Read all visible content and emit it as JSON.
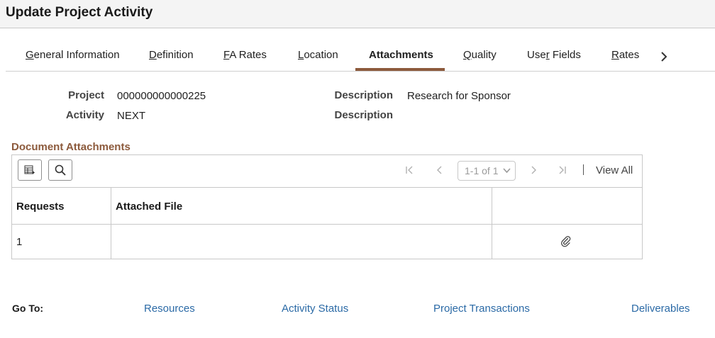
{
  "page": {
    "title": "Update Project Activity"
  },
  "tabs": [
    {
      "prefix": "",
      "underlined": "G",
      "rest": "eneral Information",
      "active": false
    },
    {
      "prefix": "",
      "underlined": "D",
      "rest": "efinition",
      "active": false
    },
    {
      "prefix": "",
      "underlined": "F",
      "rest": "A Rates",
      "active": false
    },
    {
      "prefix": "",
      "underlined": "L",
      "rest": "ocation",
      "active": false
    },
    {
      "prefix": "",
      "underlined": "",
      "rest": "Attachments",
      "active": true
    },
    {
      "prefix": "",
      "underlined": "Q",
      "rest": "uality",
      "active": false
    },
    {
      "prefix": "Use",
      "underlined": "r",
      "rest": " Fields",
      "active": false
    },
    {
      "prefix": "",
      "underlined": "R",
      "rest": "ates",
      "active": false
    }
  ],
  "header_fields": {
    "project_label": "Project",
    "project_value": "000000000000225",
    "activity_label": "Activity",
    "activity_value": "NEXT",
    "project_desc_label": "Description",
    "project_desc_value": "Research for Sponsor",
    "activity_desc_label": "Description",
    "activity_desc_value": ""
  },
  "attachments": {
    "section_title": "Document Attachments",
    "pager_text": "1-1 of 1",
    "view_all": "View All",
    "columns": [
      "Requests",
      "Attached File",
      ""
    ],
    "rows": [
      {
        "requests": "1",
        "attached_file": ""
      }
    ]
  },
  "goto": {
    "label": "Go To:",
    "links": [
      "Resources",
      "Activity Status",
      "Project Transactions",
      "Deliverables"
    ]
  },
  "colors": {
    "accent": "#8c5a3c",
    "link": "#2b6aa6"
  }
}
